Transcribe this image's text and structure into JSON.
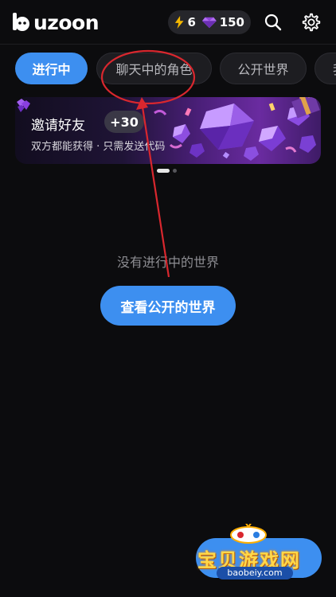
{
  "app": {
    "logo_text": "uzoon"
  },
  "header": {
    "energy_count": "6",
    "gem_count": "150"
  },
  "tabs": [
    {
      "label": "进行中",
      "active": true
    },
    {
      "label": "聊天中的角色",
      "active": false
    },
    {
      "label": "公开世界",
      "active": false
    },
    {
      "label": "我",
      "active": false
    }
  ],
  "banner": {
    "title": "邀请好友",
    "badge": "+30",
    "subtitle": "双方都能获得 · 只需发送代码"
  },
  "carousel": {
    "current": 1,
    "total": 2
  },
  "empty_state": {
    "message": "没有进行中的世界",
    "button_label": "查看公开的世界"
  },
  "watermark": {
    "text": "宝贝游戏网",
    "url": "baobeiy.com"
  },
  "colors": {
    "accent": "#3d8ff0",
    "background": "#0c0c0e",
    "annotation": "#d9272e"
  }
}
